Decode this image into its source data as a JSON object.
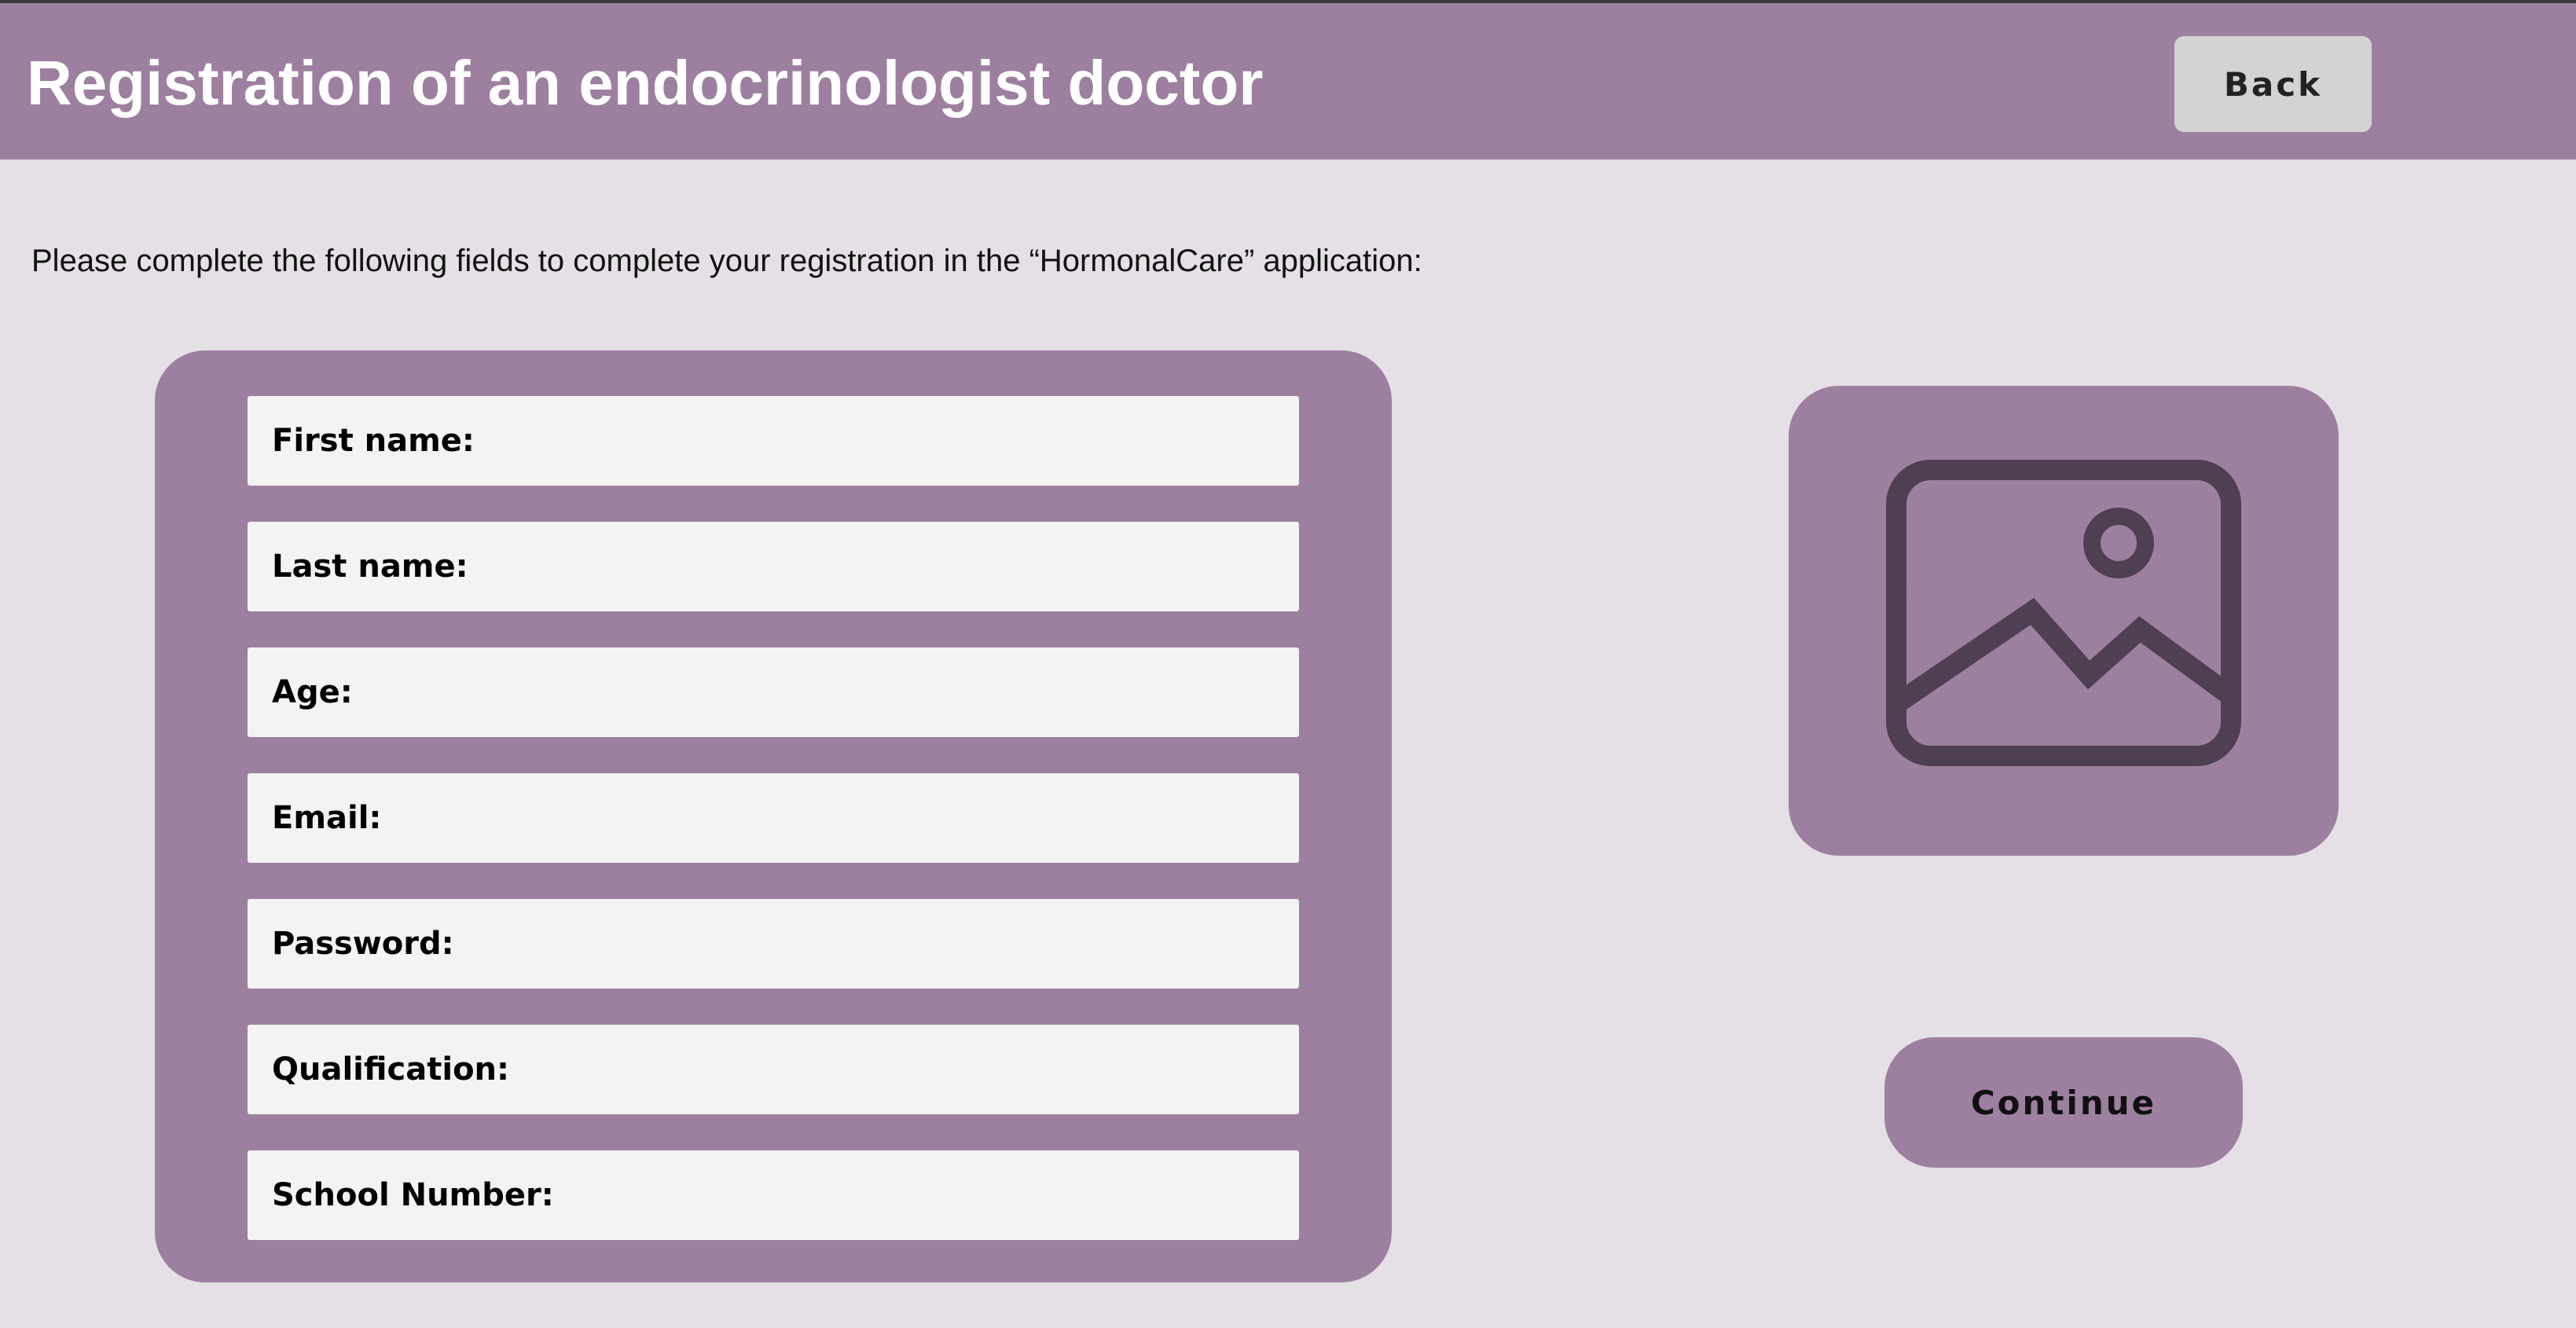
{
  "header": {
    "title": "Registration of an endocrinologist doctor",
    "back_label": "Back"
  },
  "intro": "Please complete the following fields to complete your registration in the “HormonalCare” application:",
  "form": {
    "fields": [
      {
        "label": "First name:"
      },
      {
        "label": "Last name:"
      },
      {
        "label": "Age:"
      },
      {
        "label": "Email:"
      },
      {
        "label": "Password:"
      },
      {
        "label": "Qualification:"
      },
      {
        "label": "School Number:"
      }
    ]
  },
  "photo": {
    "icon": "image-placeholder-icon"
  },
  "actions": {
    "continue_label": "Continue"
  },
  "colors": {
    "accent": "#9d809f",
    "background": "#e5dfe6",
    "field_background": "#f3f3f3",
    "back_button": "#d3d3d3",
    "icon_stroke": "#4e3f52"
  }
}
